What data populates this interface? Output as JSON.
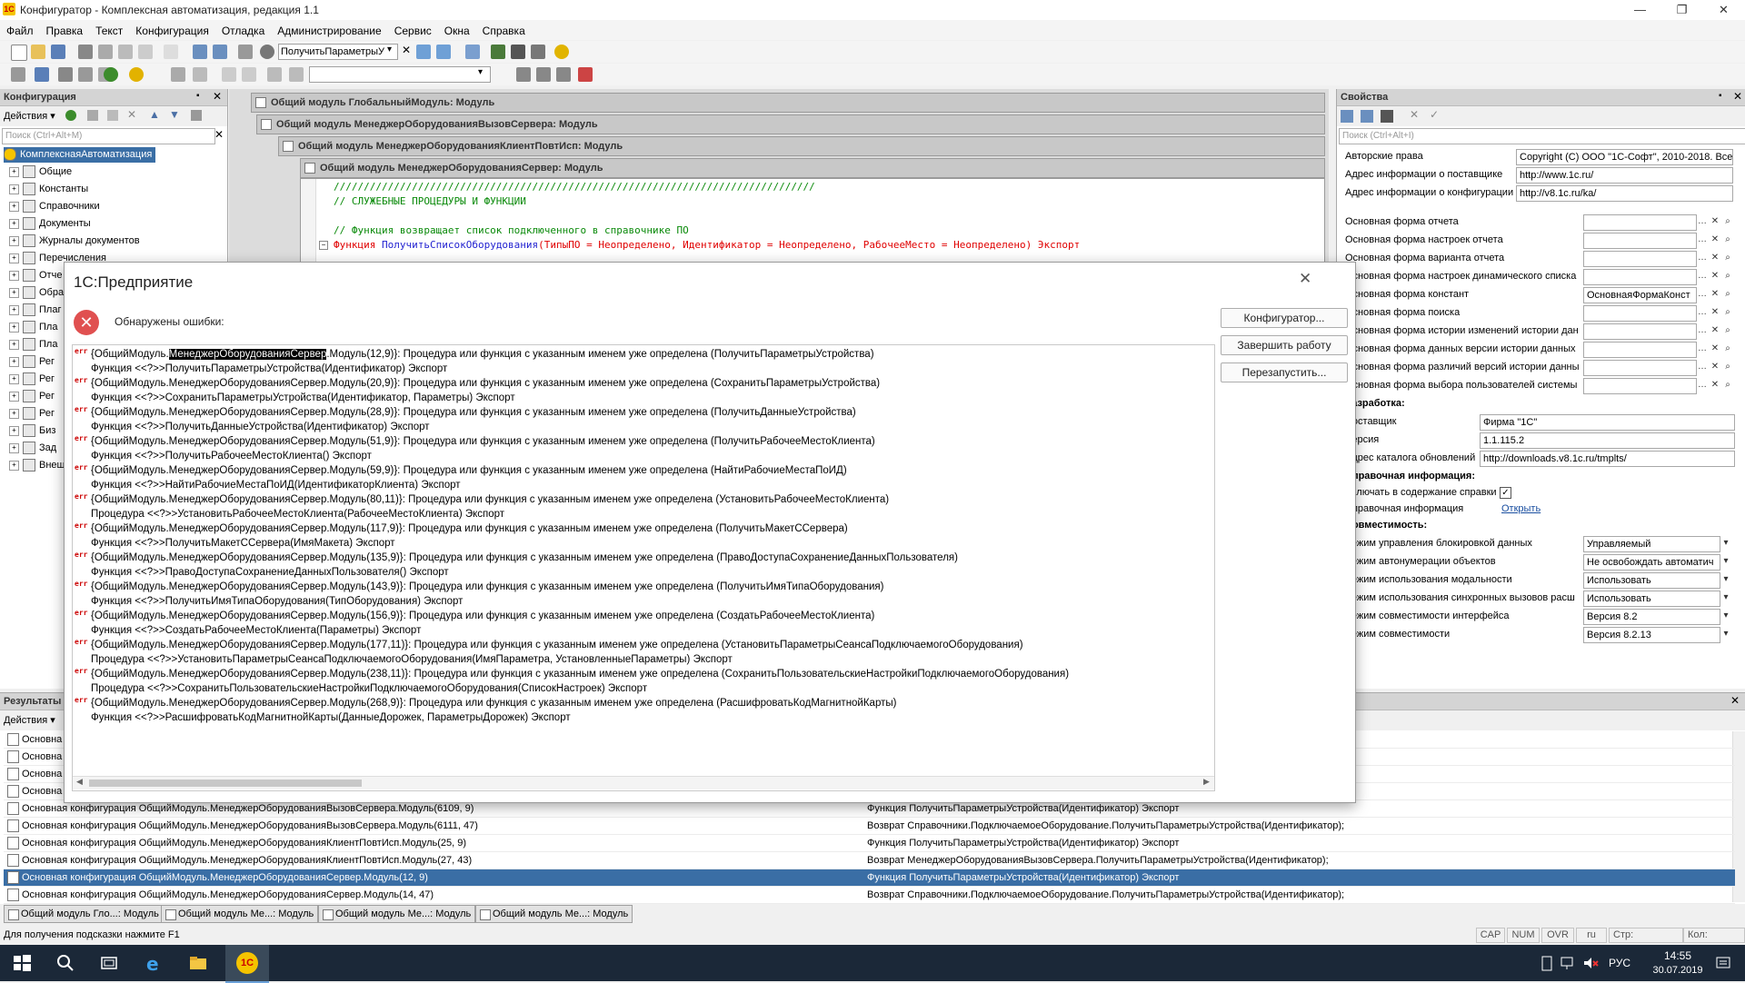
{
  "window": {
    "title": "Конфигуратор - Комплексная автоматизация, редакция 1.1",
    "app_icon": "1С"
  },
  "menu": [
    "Файл",
    "Правка",
    "Текст",
    "Конфигурация",
    "Отладка",
    "Администрирование",
    "Сервис",
    "Окна",
    "Справка"
  ],
  "toolbar": {
    "search_value": "ПолучитьПараметрыУ"
  },
  "config_panel": {
    "title": "Конфигурация",
    "actions_label": "Действия ▾",
    "search_placeholder": "Поиск (Ctrl+Alt+M)",
    "tree": [
      {
        "label": "КомплекснаяАвтоматизация",
        "selected": true
      },
      {
        "label": "Общие"
      },
      {
        "label": "Константы"
      },
      {
        "label": "Справочники"
      },
      {
        "label": "Документы"
      },
      {
        "label": "Журналы документов"
      },
      {
        "label": "Перечисления"
      },
      {
        "label": "Отче"
      },
      {
        "label": "Обра"
      },
      {
        "label": "Плаг"
      },
      {
        "label": "Пла"
      },
      {
        "label": "Пла"
      },
      {
        "label": "Рег"
      },
      {
        "label": "Рег"
      },
      {
        "label": "Рег"
      },
      {
        "label": "Рег"
      },
      {
        "label": "Биз"
      },
      {
        "label": "Зад"
      },
      {
        "label": "Внеш"
      }
    ]
  },
  "module_tabs": [
    "Общий модуль ГлобальныйМодуль: Модуль",
    "Общий модуль МенеджерОборудованияВызовСервера: Модуль",
    "Общий модуль МенеджерОборудованияКлиентПовтИсп: Модуль",
    "Общий модуль МенеджерОборудованияСервер: Модуль"
  ],
  "code": {
    "line1": "////////////////////////////////////////////////////////////////////////////////",
    "line2": "// СЛУЖЕБНЫЕ ПРОЦЕДУРЫ И ФУНКЦИИ",
    "line3": "// Функция возвращает список подключенного в справочнике ПО",
    "line4_kw": "Функция",
    "line4_name": "ПолучитьСписокОборудования",
    "line4_args": "(ТипыПО = Неопределено, Идентификатор = Неопределено, РабочееМесто = Неопределено)",
    "line4_export": "Экспорт"
  },
  "properties": {
    "title": "Свойства",
    "search_placeholder": "Поиск (Ctrl+Alt+I)",
    "rows": [
      {
        "label": "Авторские права",
        "value": "Copyright (С) ООО \"1С-Софт\", 2010-2018. Все п"
      },
      {
        "label": "Адрес информации о поставщике",
        "value": "http://www.1c.ru/"
      },
      {
        "label": "Адрес информации о конфигурации",
        "value": "http://v8.1c.ru/ka/"
      }
    ],
    "forms": [
      {
        "label": "Основная форма отчета",
        "value": ""
      },
      {
        "label": "Основная форма настроек отчета",
        "value": ""
      },
      {
        "label": "Основная форма варианта отчета",
        "value": ""
      },
      {
        "label": "Основная форма настроек динамического списка",
        "value": ""
      },
      {
        "label": "Основная форма констант",
        "value": "ОсновнаяФормаКонст"
      },
      {
        "label": "Основная форма поиска",
        "value": ""
      },
      {
        "label": "Основная форма истории изменений истории дан",
        "value": ""
      },
      {
        "label": "Основная форма данных версии истории данных",
        "value": ""
      },
      {
        "label": "Основная форма различий версий истории данны",
        "value": ""
      },
      {
        "label": "Основная форма выбора пользователей системы",
        "value": ""
      }
    ],
    "dev_header": "Разработка:",
    "dev": [
      {
        "label": "Поставщик",
        "value": "Фирма \"1С\""
      },
      {
        "label": "Версия",
        "value": "1.1.115.2"
      },
      {
        "label": "Адрес каталога обновлений",
        "value": "http://downloads.v8.1c.ru/tmplts/"
      }
    ],
    "help_header": "Справочная информация:",
    "help_include": "Включать в содержание справки",
    "help_info": "Справочная информация",
    "help_open": "Открыть",
    "compat_header": "Совместимость:",
    "compat": [
      {
        "label": "Режим управления блокировкой данных",
        "value": "Управляемый"
      },
      {
        "label": "Режим автонумерации объектов",
        "value": "Не освобождать автоматич"
      },
      {
        "label": "Режим использования модальности",
        "value": "Использовать"
      },
      {
        "label": "Режим использования синхронных вызовов расш",
        "value": "Использовать"
      },
      {
        "label": "Режим совместимости интерфейса",
        "value": "Версия 8.2"
      },
      {
        "label": "Режим совместимости",
        "value": "Версия 8.2.13"
      }
    ]
  },
  "results": {
    "title": "Результаты",
    "actions_label": "Действия ▾",
    "rows": [
      {
        "c1": "Основна",
        "c2": ""
      },
      {
        "c1": "Основна",
        "c2": ""
      },
      {
        "c1": "Основна",
        "c2": ""
      },
      {
        "c1": "Основна",
        "c2": ""
      },
      {
        "c1": "Основная конфигурация ОбщийМодуль.МенеджерОборудованияВызовСервера.Модуль(6109, 9)",
        "c2": "Функция ПолучитьПараметрыУстройства(Идентификатор) Экспорт"
      },
      {
        "c1": "Основная конфигурация ОбщийМодуль.МенеджерОборудованияВызовСервера.Модуль(6111, 47)",
        "c2": "Возврат Справочники.ПодключаемоеОборудование.ПолучитьПараметрыУстройства(Идентификатор);"
      },
      {
        "c1": "Основная конфигурация ОбщийМодуль.МенеджерОборудованияКлиентПовтИсп.Модуль(25, 9)",
        "c2": "Функция ПолучитьПараметрыУстройства(Идентификатор) Экспорт"
      },
      {
        "c1": "Основная конфигурация ОбщийМодуль.МенеджерОборудованияКлиентПовтИсп.Модуль(27, 43)",
        "c2": "Возврат МенеджерОборудованияВызовСервера.ПолучитьПараметрыУстройства(Идентификатор);"
      },
      {
        "c1": "Основная конфигурация ОбщийМодуль.МенеджерОборудованияСервер.Модуль(12, 9)",
        "c2": "Функция ПолучитьПараметрыУстройства(Идентификатор) Экспорт",
        "selected": true
      },
      {
        "c1": "Основная конфигурация ОбщийМодуль.МенеджерОборудованияСервер.Модуль(14, 47)",
        "c2": "Возврат Справочники.ПодключаемоеОборудование.ПолучитьПараметрыУстройства(Идентификатор);"
      }
    ]
  },
  "window_tabs": [
    "Общий модуль Гло...: Модуль",
    "Общий модуль Ме...: Модуль",
    "Общий модуль Ме...: Модуль",
    "Общий модуль Ме...: Модуль"
  ],
  "status": {
    "hint": "Для получения подсказки нажмите F1",
    "cap": "CAP",
    "num": "NUM",
    "ovr": "OVR",
    "lang": "ru",
    "line": "Стр:",
    "col": "Кол:"
  },
  "dialog": {
    "title": "1С:Предприятие",
    "message": "Обнаружены ошибки:",
    "buttons": [
      "Конфигуратор...",
      "Завершить работу",
      "Перезапустить..."
    ],
    "err_tag": "err",
    "highlight": "МенеджерОборудованияСервер",
    "errors": [
      {
        "pre": "{ОбщийМодуль.",
        "hl": true,
        "rest": ".Модуль(12,9)}: Процедура или функция с указанным именем уже определена (ПолучитьПараметрыУстройства)",
        "sub": "Функция <<?>>ПолучитьПараметрыУстройства(Идентификатор) Экспорт"
      },
      {
        "pre": "{ОбщийМодуль.МенеджерОборудованияСервер.Модуль(20,9)}: Процедура или функция с указанным именем уже определена (СохранитьПараметрыУстройства)",
        "sub": "Функция <<?>>СохранитьПараметрыУстройства(Идентификатор, Параметры) Экспорт"
      },
      {
        "pre": "{ОбщийМодуль.МенеджерОборудованияСервер.Модуль(28,9)}: Процедура или функция с указанным именем уже определена (ПолучитьДанныеУстройства)",
        "sub": "Функция <<?>>ПолучитьДанныеУстройства(Идентификатор) Экспорт"
      },
      {
        "pre": "{ОбщийМодуль.МенеджерОборудованияСервер.Модуль(51,9)}: Процедура или функция с указанным именем уже определена (ПолучитьРабочееМестоКлиента)",
        "sub": "Функция <<?>>ПолучитьРабочееМестоКлиента() Экспорт"
      },
      {
        "pre": "{ОбщийМодуль.МенеджерОборудованияСервер.Модуль(59,9)}: Процедура или функция с указанным именем уже определена (НайтиРабочиеМестаПоИД)",
        "sub": "Функция <<?>>НайтиРабочиеМестаПоИД(ИдентификаторКлиента) Экспорт"
      },
      {
        "pre": "{ОбщийМодуль.МенеджерОборудованияСервер.Модуль(80,11)}: Процедура или функция с указанным именем уже определена (УстановитьРабочееМестоКлиента)",
        "sub": "Процедура <<?>>УстановитьРабочееМестоКлиента(РабочееМестоКлиента) Экспорт"
      },
      {
        "pre": "{ОбщийМодуль.МенеджерОборудованияСервер.Модуль(117,9)}: Процедура или функция с указанным именем уже определена (ПолучитьМакетССервера)",
        "sub": "Функция <<?>>ПолучитьМакетССервера(ИмяМакета) Экспорт"
      },
      {
        "pre": "{ОбщийМодуль.МенеджерОборудованияСервер.Модуль(135,9)}: Процедура или функция с указанным именем уже определена (ПравоДоступаСохранениеДанныхПользователя)",
        "sub": "Функция <<?>>ПравоДоступаСохранениеДанныхПользователя() Экспорт"
      },
      {
        "pre": "{ОбщийМодуль.МенеджерОборудованияСервер.Модуль(143,9)}: Процедура или функция с указанным именем уже определена (ПолучитьИмяТипаОборудования)",
        "sub": "Функция <<?>>ПолучитьИмяТипаОборудования(ТипОборудования) Экспорт"
      },
      {
        "pre": "{ОбщийМодуль.МенеджерОборудованияСервер.Модуль(156,9)}: Процедура или функция с указанным именем уже определена (СоздатьРабочееМестоКлиента)",
        "sub": "Функция <<?>>СоздатьРабочееМестоКлиента(Параметры) Экспорт"
      },
      {
        "pre": "{ОбщийМодуль.МенеджерОборудованияСервер.Модуль(177,11)}: Процедура или функция с указанным именем уже определена (УстановитьПараметрыСеансаПодключаемогоОборудования)",
        "sub": "Процедура <<?>>УстановитьПараметрыСеансаПодключаемогоОборудования(ИмяПараметра, УстановленныеПараметры) Экспорт"
      },
      {
        "pre": "{ОбщийМодуль.МенеджерОборудованияСервер.Модуль(238,11)}: Процедура или функция с указанным именем уже определена (СохранитьПользовательскиеНастройкиПодключаемогоОборудования)",
        "sub": "Процедура <<?>>СохранитьПользовательскиеНастройкиПодключаемогоОборудования(СписокНастроек) Экспорт"
      },
      {
        "pre": "{ОбщийМодуль.МенеджерОборудованияСервер.Модуль(268,9)}: Процедура или функция с указанным именем уже определена (РасшифроватьКодМагнитнойКарты)",
        "sub": "Функция <<?>>РасшифроватьКодМагнитнойКарты(ДанныеДорожек, ПараметрыДорожек) Экспорт"
      }
    ]
  },
  "taskbar": {
    "lang": "РУС",
    "time": "14:55",
    "date": "30.07.2019"
  }
}
